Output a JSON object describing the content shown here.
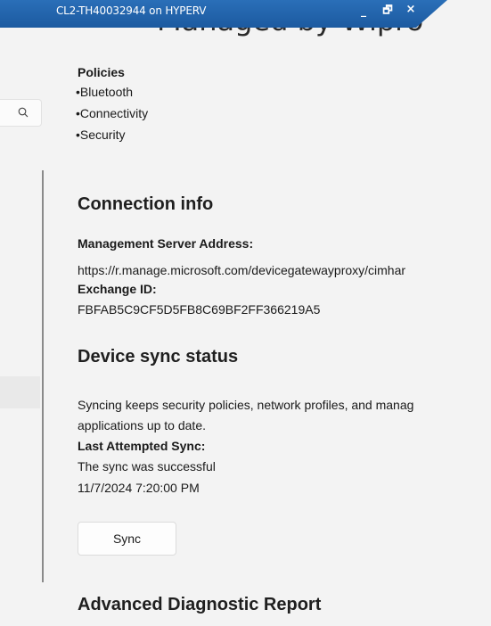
{
  "session": {
    "title": "CL2-TH40032944 on HYPERV",
    "minimize": "_",
    "restore": "🗗",
    "close": "×"
  },
  "header": {
    "partial_heading": "Managed by Wipro"
  },
  "sidebar": {
    "search_icon": "search-icon"
  },
  "policies": {
    "label": "Policies",
    "items": [
      "•Bluetooth",
      "•Connectivity",
      "•Security"
    ]
  },
  "connection_info": {
    "title": "Connection info",
    "server_label": "Management Server Address:",
    "server_value": "https://r.manage.microsoft.com/devicegatewayproxy/cimhar",
    "exchange_label": "Exchange ID:",
    "exchange_value": "FBFAB5C9CF5D5FB8C69BF2FF366219A5"
  },
  "sync_status": {
    "title": "Device sync status",
    "description_line1": "Syncing keeps security policies, network profiles, and manag",
    "description_line2": "applications up to date.",
    "last_sync_label": "Last Attempted Sync:",
    "result": "The sync was successful",
    "timestamp": "11/7/2024 7:20:00 PM",
    "sync_button": "Sync"
  },
  "diagnostics": {
    "title": "Advanced Diagnostic Report"
  }
}
